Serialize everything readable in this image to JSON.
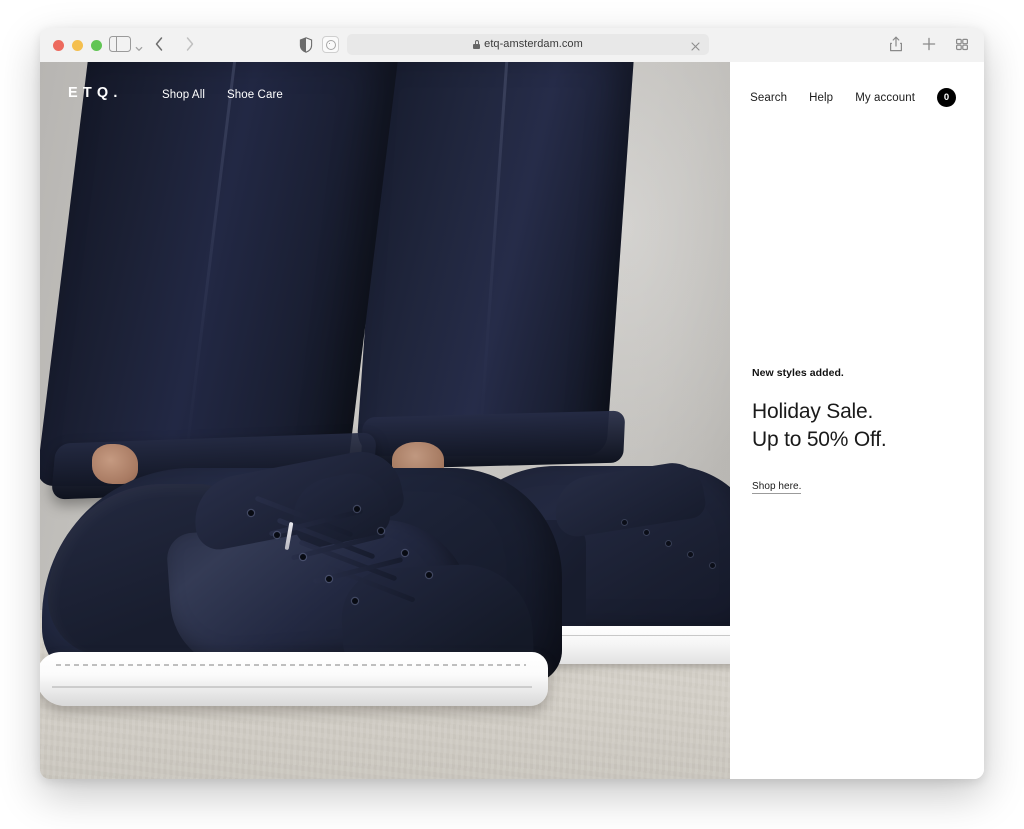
{
  "browser": {
    "window_controls": {
      "close_label": "close",
      "minimize_label": "minimize",
      "maximize_label": "maximize"
    },
    "sidebar_toggle_label": "Show sidebar",
    "back_label": "Back",
    "forward_label": "Forward",
    "privacy_label": "Privacy Report",
    "reload_label": "Reload",
    "address": {
      "url": "etq-amsterdam.com",
      "secure": true,
      "lock_icon": "lock-icon",
      "clear_icon": "close-icon"
    },
    "actions": {
      "share_icon": "share-icon",
      "new_tab_icon": "plus-icon",
      "tab_overview_icon": "grid-icon"
    }
  },
  "site": {
    "brand": "ETQ.",
    "nav_left": [
      {
        "label": "Shop All"
      },
      {
        "label": "Shoe Care"
      }
    ],
    "nav_right": [
      {
        "label": "Search"
      },
      {
        "label": "Help"
      },
      {
        "label": "My account"
      }
    ],
    "cart_count": "0",
    "promo": {
      "eyebrow": "New styles added.",
      "headline_line1": "Holiday Sale.",
      "headline_line2": "Up to 50% Off.",
      "cta": "Shop here."
    }
  },
  "colors": {
    "toolbar_bg": "#f2f2f2",
    "urlbar_bg": "#e8e8e8",
    "panel_bg": "#ffffff",
    "cart_badge_bg": "#000000",
    "navy": "#1b2134",
    "traffic_close": "#ed6a5e",
    "traffic_min": "#f4bf4f",
    "traffic_max": "#61c554"
  }
}
